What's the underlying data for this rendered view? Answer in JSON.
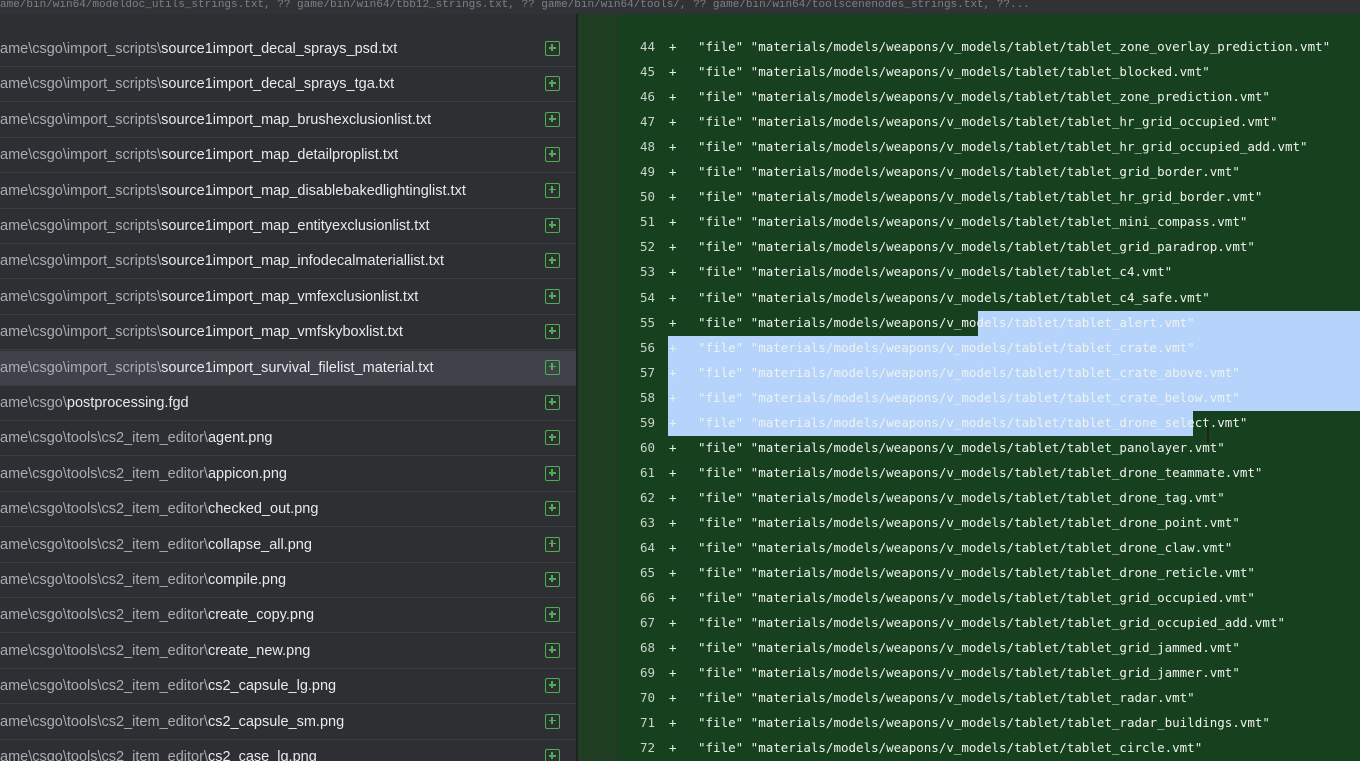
{
  "topbar": {
    "text": "ame/bin/win64/modeldoc_utils_strings.txt, ?? game/bin/win64/tbb12_strings.txt, ?? game/bin/win64/tools/, ?? game/bin/win64/toolscenenodes_strings.txt, ??..."
  },
  "files": [
    {
      "dir": "ame\\csgo\\import_scripts\\",
      "name": "source1import_decal_sprays_psd.txt"
    },
    {
      "dir": "ame\\csgo\\import_scripts\\",
      "name": "source1import_decal_sprays_tga.txt"
    },
    {
      "dir": "ame\\csgo\\import_scripts\\",
      "name": "source1import_map_brushexclusionlist.txt"
    },
    {
      "dir": "ame\\csgo\\import_scripts\\",
      "name": "source1import_map_detailproplist.txt"
    },
    {
      "dir": "ame\\csgo\\import_scripts\\",
      "name": "source1import_map_disablebakedlightinglist.txt"
    },
    {
      "dir": "ame\\csgo\\import_scripts\\",
      "name": "source1import_map_entityexclusionlist.txt"
    },
    {
      "dir": "ame\\csgo\\import_scripts\\",
      "name": "source1import_map_infodecalmateriallist.txt"
    },
    {
      "dir": "ame\\csgo\\import_scripts\\",
      "name": "source1import_map_vmfexclusionlist.txt"
    },
    {
      "dir": "ame\\csgo\\import_scripts\\",
      "name": "source1import_map_vmfskyboxlist.txt"
    },
    {
      "dir": "ame\\csgo\\import_scripts\\",
      "name": "source1import_survival_filelist_material.txt",
      "selected": true
    },
    {
      "dir": "ame\\csgo\\",
      "name": "postprocessing.fgd"
    },
    {
      "dir": "ame\\csgo\\tools\\cs2_item_editor\\",
      "name": "agent.png"
    },
    {
      "dir": "ame\\csgo\\tools\\cs2_item_editor\\",
      "name": "appicon.png"
    },
    {
      "dir": "ame\\csgo\\tools\\cs2_item_editor\\",
      "name": "checked_out.png"
    },
    {
      "dir": "ame\\csgo\\tools\\cs2_item_editor\\",
      "name": "collapse_all.png"
    },
    {
      "dir": "ame\\csgo\\tools\\cs2_item_editor\\",
      "name": "compile.png"
    },
    {
      "dir": "ame\\csgo\\tools\\cs2_item_editor\\",
      "name": "create_copy.png"
    },
    {
      "dir": "ame\\csgo\\tools\\cs2_item_editor\\",
      "name": "create_new.png"
    },
    {
      "dir": "ame\\csgo\\tools\\cs2_item_editor\\",
      "name": "cs2_capsule_lg.png"
    },
    {
      "dir": "ame\\csgo\\tools\\cs2_item_editor\\",
      "name": "cs2_capsule_sm.png"
    },
    {
      "dir": "ame\\csgo\\tools\\cs2_item_editor\\",
      "name": "cs2_case_lg.png"
    }
  ],
  "diff_lines": [
    {
      "n": "44",
      "sign": "+",
      "code": "\"file\" \"materials/models/weapons/v_models/tablet/tablet_zone_overlay_prediction.vmt\""
    },
    {
      "n": "45",
      "sign": "+",
      "code": "\"file\" \"materials/models/weapons/v_models/tablet/tablet_blocked.vmt\""
    },
    {
      "n": "46",
      "sign": "+",
      "code": "\"file\" \"materials/models/weapons/v_models/tablet/tablet_zone_prediction.vmt\""
    },
    {
      "n": "47",
      "sign": "+",
      "code": "\"file\" \"materials/models/weapons/v_models/tablet/tablet_hr_grid_occupied.vmt\""
    },
    {
      "n": "48",
      "sign": "+",
      "code": "\"file\" \"materials/models/weapons/v_models/tablet/tablet_hr_grid_occupied_add.vmt\""
    },
    {
      "n": "49",
      "sign": "+",
      "code": "\"file\" \"materials/models/weapons/v_models/tablet/tablet_grid_border.vmt\""
    },
    {
      "n": "50",
      "sign": "+",
      "code": "\"file\" \"materials/models/weapons/v_models/tablet/tablet_hr_grid_border.vmt\""
    },
    {
      "n": "51",
      "sign": "+",
      "code": "\"file\" \"materials/models/weapons/v_models/tablet/tablet_mini_compass.vmt\""
    },
    {
      "n": "52",
      "sign": "+",
      "code": "\"file\" \"materials/models/weapons/v_models/tablet/tablet_grid_paradrop.vmt\""
    },
    {
      "n": "53",
      "sign": "+",
      "code": "\"file\" \"materials/models/weapons/v_models/tablet/tablet_c4.vmt\""
    },
    {
      "n": "54",
      "sign": "+",
      "code": "\"file\" \"materials/models/weapons/v_models/tablet/tablet_c4_safe.vmt\""
    },
    {
      "n": "55",
      "sign": "+",
      "code": "\"file\" \"materials/models/weapons/v_models/tablet/tablet_alert.vmt\""
    },
    {
      "n": "56",
      "sign": "+",
      "code": "\"file\" \"materials/models/weapons/v_models/tablet/tablet_crate.vmt\""
    },
    {
      "n": "57",
      "sign": "+",
      "code": "\"file\" \"materials/models/weapons/v_models/tablet/tablet_crate_above.vmt\""
    },
    {
      "n": "58",
      "sign": "+",
      "code": "\"file\" \"materials/models/weapons/v_models/tablet/tablet_crate_below.vmt\""
    },
    {
      "n": "59",
      "sign": "+",
      "code": "\"file\" \"materials/models/weapons/v_models/tablet/tablet_drone_select.vmt\""
    },
    {
      "n": "60",
      "sign": "+",
      "code": "\"file\" \"materials/models/weapons/v_models/tablet/tablet_panolayer.vmt\""
    },
    {
      "n": "61",
      "sign": "+",
      "code": "\"file\" \"materials/models/weapons/v_models/tablet/tablet_drone_teammate.vmt\""
    },
    {
      "n": "62",
      "sign": "+",
      "code": "\"file\" \"materials/models/weapons/v_models/tablet/tablet_drone_tag.vmt\""
    },
    {
      "n": "63",
      "sign": "+",
      "code": "\"file\" \"materials/models/weapons/v_models/tablet/tablet_drone_point.vmt\""
    },
    {
      "n": "64",
      "sign": "+",
      "code": "\"file\" \"materials/models/weapons/v_models/tablet/tablet_drone_claw.vmt\""
    },
    {
      "n": "65",
      "sign": "+",
      "code": "\"file\" \"materials/models/weapons/v_models/tablet/tablet_drone_reticle.vmt\""
    },
    {
      "n": "66",
      "sign": "+",
      "code": "\"file\" \"materials/models/weapons/v_models/tablet/tablet_grid_occupied.vmt\""
    },
    {
      "n": "67",
      "sign": "+",
      "code": "\"file\" \"materials/models/weapons/v_models/tablet/tablet_grid_occupied_add.vmt\""
    },
    {
      "n": "68",
      "sign": "+",
      "code": "\"file\" \"materials/models/weapons/v_models/tablet/tablet_grid_jammed.vmt\""
    },
    {
      "n": "69",
      "sign": "+",
      "code": "\"file\" \"materials/models/weapons/v_models/tablet/tablet_grid_jammer.vmt\""
    },
    {
      "n": "70",
      "sign": "+",
      "code": "\"file\" \"materials/models/weapons/v_models/tablet/tablet_radar.vmt\""
    },
    {
      "n": "71",
      "sign": "+",
      "code": "\"file\" \"materials/models/weapons/v_models/tablet/tablet_radar_buildings.vmt\""
    },
    {
      "n": "72",
      "sign": "+",
      "code": "\"file\" \"materials/models/weapons/v_models/tablet/tablet_circle.vmt\""
    }
  ],
  "colors": {
    "added_icon": "#4caf50",
    "diff_bg": "#17401f",
    "selection": "#b6d3fb"
  }
}
